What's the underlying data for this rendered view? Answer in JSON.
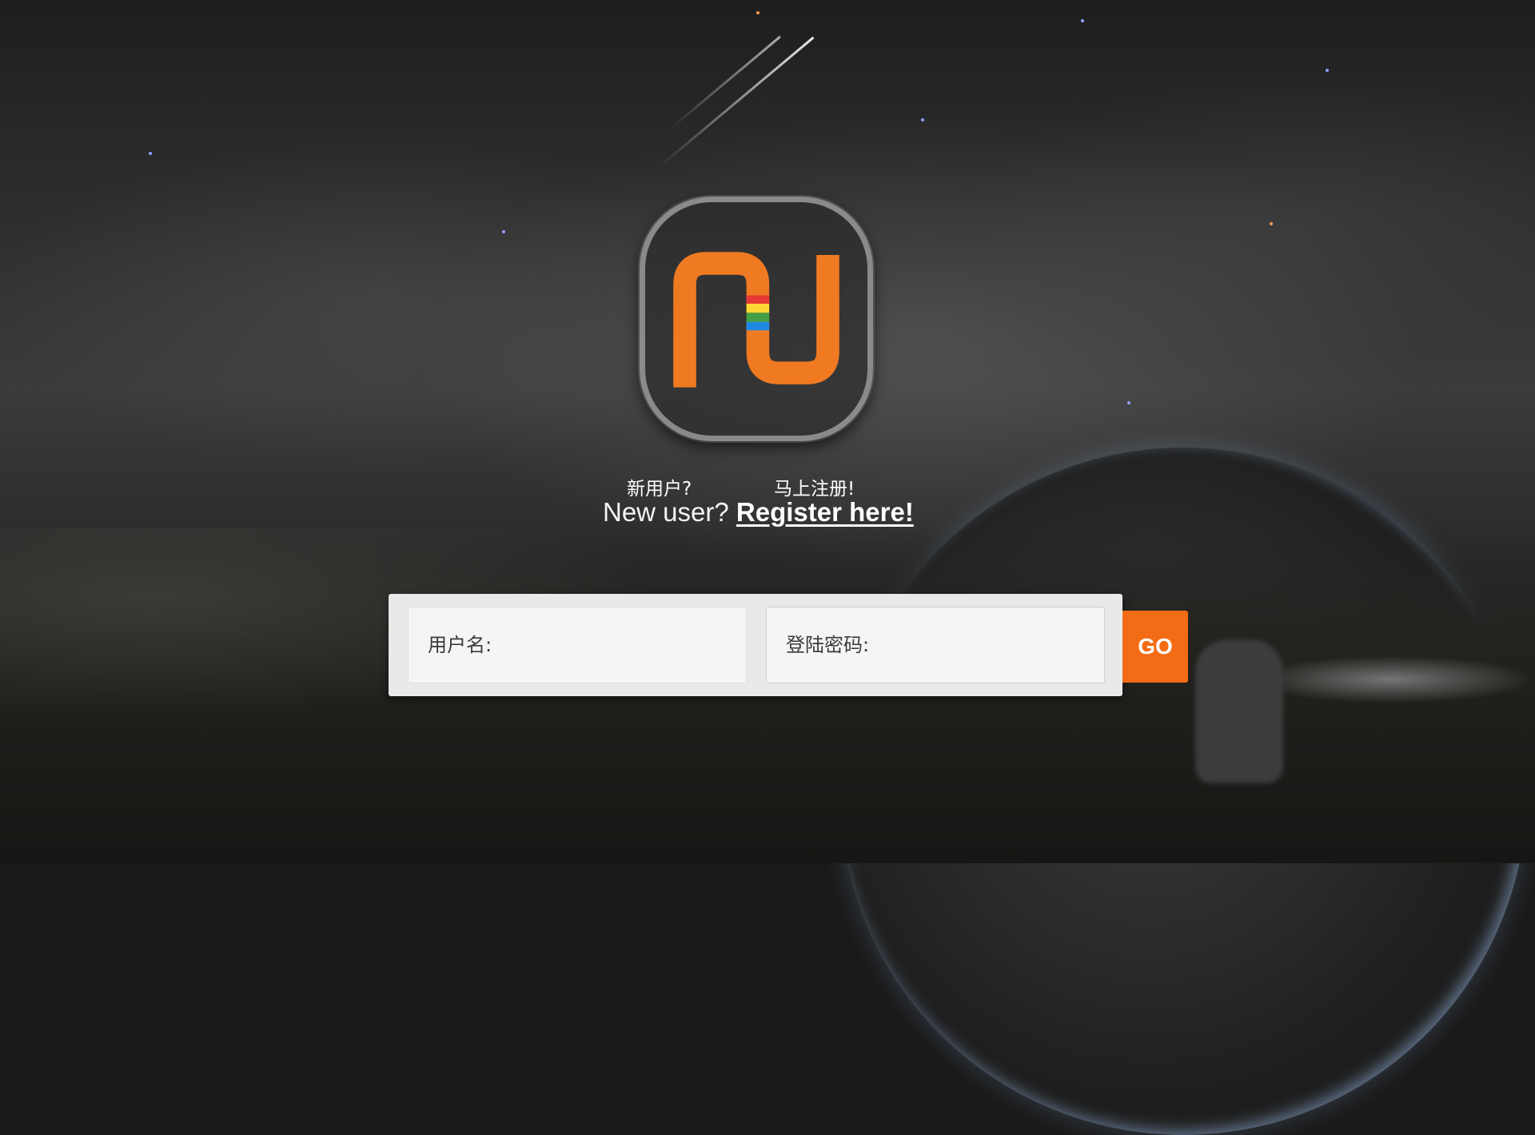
{
  "brand": {
    "logo_icon": "nu-rainbow-logo-icon",
    "accent_color": "#f07a22",
    "rainbow_colors": [
      "#e53935",
      "#fdd835",
      "#43a047",
      "#1e88e5"
    ]
  },
  "register": {
    "cn_new_user": "新用户?",
    "cn_register_now": "马上注册!",
    "en_new_user": "New user?",
    "en_register_link": "Register here!"
  },
  "login": {
    "username_placeholder": "用户名:",
    "password_placeholder": "登陆密码:",
    "submit_label": "GO",
    "submit_color": "#f36b14"
  }
}
